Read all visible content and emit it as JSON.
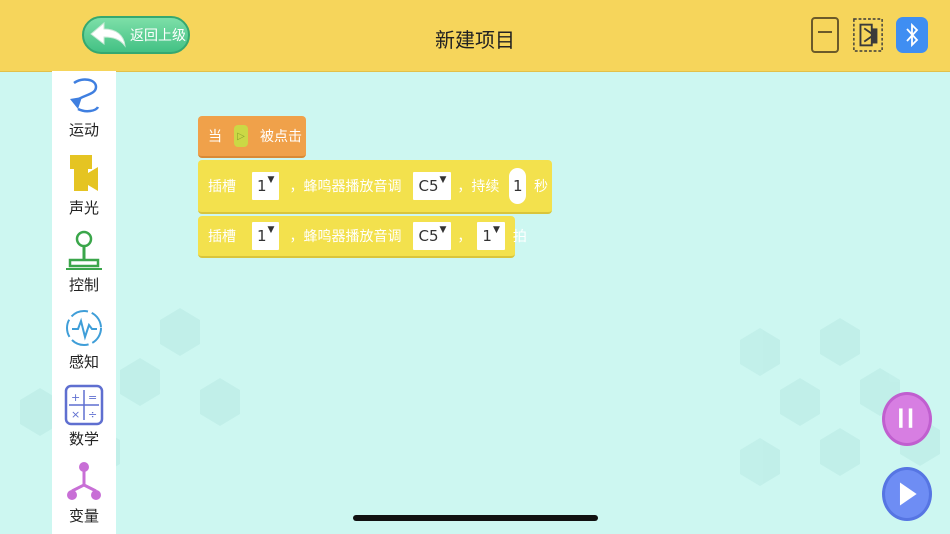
{
  "header": {
    "title": "新建项目",
    "back_label": "返回上级"
  },
  "sidebar": {
    "items": [
      {
        "label": "运动",
        "icon": "motion-icon"
      },
      {
        "label": "声光",
        "icon": "sound-light-icon"
      },
      {
        "label": "控制",
        "icon": "control-icon"
      },
      {
        "label": "感知",
        "icon": "sensing-icon"
      },
      {
        "label": "数学",
        "icon": "math-icon"
      },
      {
        "label": "变量",
        "icon": "variable-icon"
      }
    ]
  },
  "blocks": {
    "hat": {
      "prefix": "当",
      "suffix": "被点击"
    },
    "tone_seconds": {
      "slot_label": "插槽",
      "slot_value": "1",
      "text": "，蜂鸣器播放音调",
      "tone_value": "C5",
      "duration_label": "，持续",
      "duration_value": "1",
      "unit": "秒"
    },
    "tone_beats": {
      "slot_label": "插槽",
      "slot_value": "1",
      "text": "，蜂鸣器播放音调",
      "tone_value": "C5",
      "comma": "，",
      "beat_value": "1",
      "unit": "拍"
    }
  },
  "colors": {
    "topbar": "#f6d55b",
    "canvas": "#cdf7f1",
    "hat_block": "#f0a14a",
    "sound_block": "#f3e14d",
    "back_button": "#43c184",
    "pause_button": "#d77ee2",
    "play_button": "#6e8df4",
    "bluetooth_button": "#3f8ef2"
  }
}
